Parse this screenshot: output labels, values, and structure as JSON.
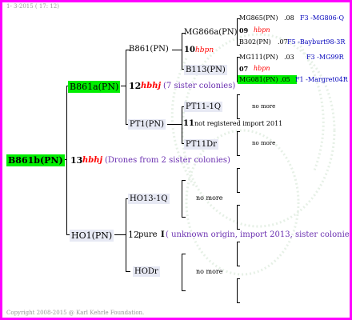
{
  "header": {
    "date": "1-  3-2015 ( 17: 12)"
  },
  "footer": {
    "copyright": "Copyright 2008-2015 @ Karl Kehrle Foundation."
  },
  "root": {
    "name": "B861b(PN)",
    "num": "13",
    "tag": "hbhj",
    "desc": "(Drones from 2 sister colonies)"
  },
  "mother": {
    "name": "B861a(PN)",
    "num": "12",
    "tag": "hbhj",
    "desc": "(7 sister colonies)"
  },
  "father": {
    "name": "HO1(PN)",
    "num": "12",
    "tag": "pure",
    "mark": "I",
    "desc": "( unknown origin, import 2013, sister colonies"
  },
  "gm_m": {
    "name": "B861(PN)"
  },
  "gm_f": {
    "name": "PT1(PN)",
    "num": "11",
    "desc": "not registered import 2011"
  },
  "gf_m": {
    "name": "HO13-1Q",
    "desc": "no more"
  },
  "gf_f": {
    "name": "HODr",
    "desc": "no more"
  },
  "g3_1": {
    "name": "MG866a(PN)",
    "num": "10",
    "tag": "hbpn"
  },
  "g3_2": {
    "name": "B113(PN)"
  },
  "g3_3": {
    "name": "PT11-1Q",
    "desc": "no more"
  },
  "g3_4": {
    "name": "PT11Dr",
    "desc": "no more"
  },
  "g4_1": {
    "name": "MG865(PN)",
    "num": ".08",
    "code": "F3 -MG806-Q"
  },
  "g4_2": {
    "num": "09",
    "tag": "hbpn"
  },
  "g4_3": {
    "name": "B302(PN)",
    "num": ".07",
    "code": "F5 -Bayburt98-3R"
  },
  "g4_4": {
    "name": "MG111(PN)",
    "num": ".03",
    "code": "F3 -MG99R"
  },
  "g4_5": {
    "num": "07",
    "tag": "hbpn"
  },
  "g4_6": {
    "name": "MG081(PN)",
    "num": ".05",
    "code": "F1 -Margret04R"
  },
  "colors": {
    "border": "#ff00ff",
    "highlight": "#00ee00",
    "box": "#e7e9f4",
    "tag": "#ff0000",
    "desc": "#6a2fb0",
    "code": "#0000bb"
  }
}
